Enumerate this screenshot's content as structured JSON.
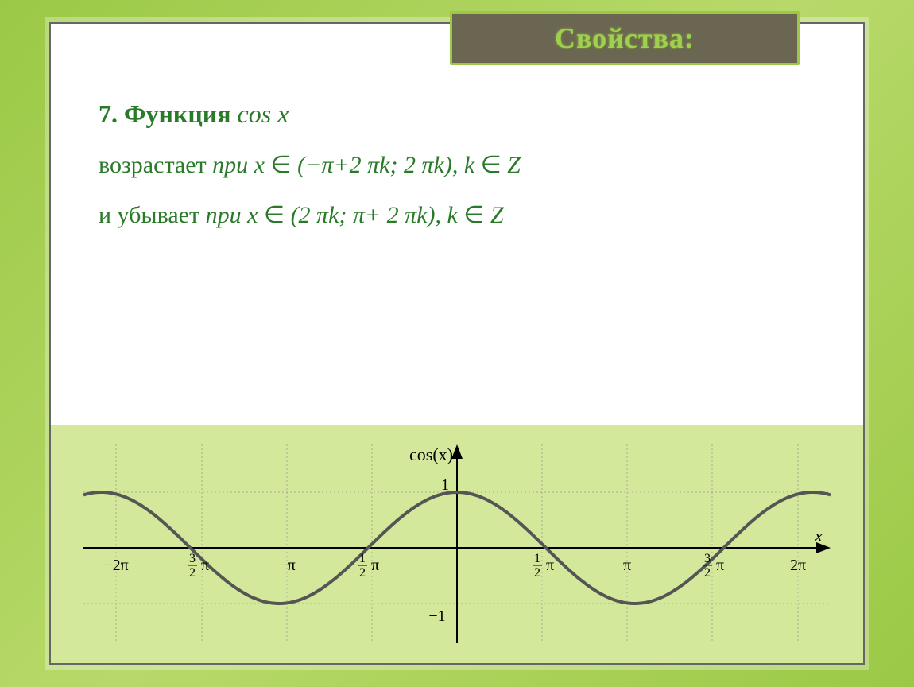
{
  "header": {
    "title": "Свойства:"
  },
  "content": {
    "line1_prefix": "7. Функция ",
    "line1_func": "cos x",
    "line2_pre": "возрастает ",
    "line2_mid": "при x ",
    "line2_post": "(−π+2 πk; 2 πk), k ",
    "line2_end": "Z",
    "line3_pre": "и убывает ",
    "line3_mid": "при x ",
    "line3_post": "(2 πk; π+ 2 πk), k ",
    "line3_end": "Z",
    "elem_symbol": "∈"
  },
  "chart_data": {
    "type": "line",
    "title": "cos(x)",
    "xlabel": "x",
    "ylabel": "",
    "xlim": [
      -6.6,
      6.6
    ],
    "ylim": [
      -1.2,
      1.2
    ],
    "x_ticks": [
      {
        "value": -6.2832,
        "label": "−2π"
      },
      {
        "value": -4.7124,
        "label": "−3/2 π"
      },
      {
        "value": -3.1416,
        "label": "−π"
      },
      {
        "value": -1.5708,
        "label": "−1/2 π"
      },
      {
        "value": 1.5708,
        "label": "1/2 π"
      },
      {
        "value": 3.1416,
        "label": "π"
      },
      {
        "value": 4.7124,
        "label": "3/2 π"
      },
      {
        "value": 6.2832,
        "label": "2π"
      }
    ],
    "y_ticks": [
      {
        "value": 1,
        "label": "1"
      },
      {
        "value": -1,
        "label": "−1"
      }
    ],
    "series": [
      {
        "name": "cos(x)",
        "function": "cos",
        "domain": [
          -6.6,
          6.6
        ]
      }
    ]
  }
}
